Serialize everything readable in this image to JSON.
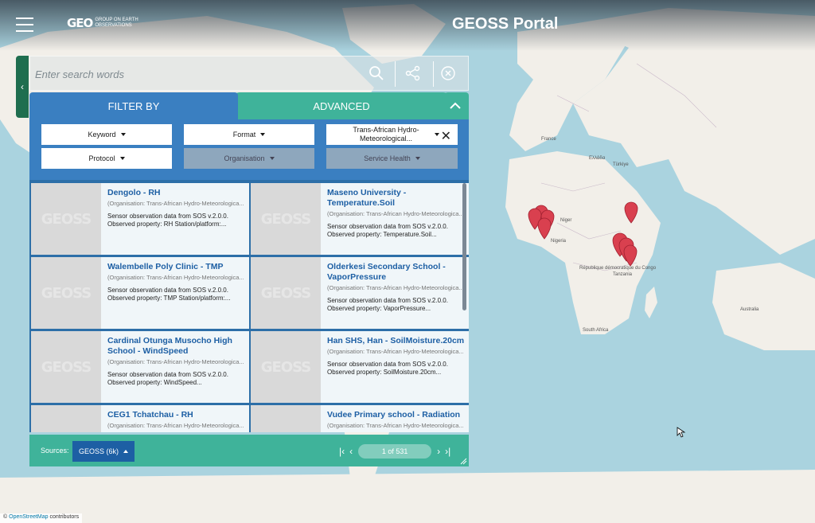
{
  "header": {
    "geo_logo_big": "GEO",
    "geo_logo_small": "GROUP ON EARTH OBSERVATIONS",
    "portal_title": "GEOSS Portal"
  },
  "search": {
    "placeholder": "Enter search words"
  },
  "tabs": {
    "filter_by": "FILTER BY",
    "advanced": "ADVANCED"
  },
  "filters": {
    "keyword": "Keyword",
    "format": "Format",
    "organisation_selected": "Trans-African Hydro-Meteorological...",
    "protocol": "Protocol",
    "organisation": "Organisation",
    "service_health": "Service Health"
  },
  "results": [
    {
      "title": "Dengolo - RH",
      "org": "(Organisation: Trans-African Hydro-Meteorologica...",
      "desc1": "Sensor observation data from SOS v.2.0.0.",
      "desc2": "Observed property: RH Station/platform:..."
    },
    {
      "title": "Maseno University - Temperature.Soil",
      "org": "(Organisation: Trans-African Hydro-Meteorologica...",
      "desc1": "Sensor observation data from SOS v.2.0.0.",
      "desc2": "Observed property: Temperature.Soil..."
    },
    {
      "title": "Walembelle Poly Clinic - TMP",
      "org": "(Organisation: Trans-African Hydro-Meteorologica...",
      "desc1": "Sensor observation data from SOS v.2.0.0.",
      "desc2": "Observed property: TMP Station/platform:..."
    },
    {
      "title": "Olderkesi Secondary School - VaporPressure",
      "org": "(Organisation: Trans-African Hydro-Meteorologica...",
      "desc1": "Sensor observation data from SOS v.2.0.0.",
      "desc2": "Observed property: VaporPressure..."
    },
    {
      "title": "Cardinal Otunga Musocho High School - WindSpeed",
      "org": "(Organisation: Trans-African Hydro-Meteorologica...",
      "desc1": "Sensor observation data from SOS v.2.0.0.",
      "desc2": "Observed property: WindSpeed..."
    },
    {
      "title": "Han SHS, Han - SoilMoisture.20cm",
      "org": "(Organisation: Trans-African Hydro-Meteorologica...",
      "desc1": "Sensor observation data from SOS v.2.0.0.",
      "desc2": "Observed property: SoilMoisture.20cm..."
    },
    {
      "title": "CEG1 Tchatchau - RH",
      "org": "(Organisation: Trans-African Hydro-Meteorologica...",
      "desc1": "",
      "desc2": ""
    },
    {
      "title": "Vudee Primary school - Radiation",
      "org": "(Organisation: Trans-African Hydro-Meteorologica...",
      "desc1": "",
      "desc2": ""
    }
  ],
  "thumb_watermark": "GEOSS",
  "footer": {
    "sources_label": "Sources:",
    "sources_button": "GEOSS (6k)",
    "page_indicator": "1 of 531"
  },
  "attribution": {
    "symbol": "©",
    "link": "OpenStreetMap",
    "suffix": "contributors"
  },
  "map_labels": [
    "France",
    "Türkiye",
    "Ελλάδα",
    "Niger",
    "Nigeria",
    "South Africa",
    "République démocratique du Congo",
    "Tanzania",
    "Australia"
  ],
  "colors": {
    "filter_blue": "#3a7fc1",
    "teal": "#3fb39a",
    "link_blue": "#1d5fa4",
    "marker_red": "#d9404f"
  }
}
